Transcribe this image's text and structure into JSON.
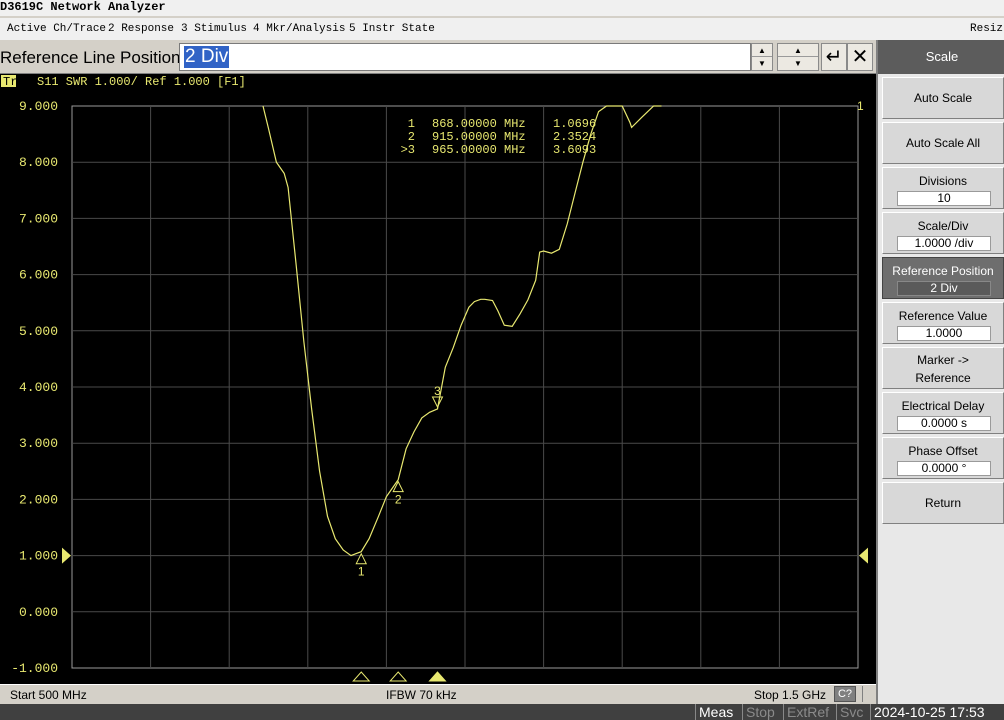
{
  "window": {
    "title": "D3619C Network Analyzer"
  },
  "menu": {
    "items": [
      "Active Ch/Trace",
      "2 Response",
      "3 Stimulus",
      "4 Mkr/Analysis",
      "5 Instr State"
    ],
    "resize_label": "Resiz"
  },
  "entry": {
    "label": "Reference Line Position",
    "value": "2 Div"
  },
  "trace": {
    "badge": "Tr1",
    "header": "S11  SWR 1.000/ Ref 1.000 [F1]",
    "color": "#e8e870",
    "ref_right_label": "1"
  },
  "markers": {
    "readout": [
      {
        "prefix": "1",
        "freq": "868.00000 MHz",
        "value": "1.0696"
      },
      {
        "prefix": "2",
        "freq": "915.00000 MHz",
        "value": "2.3524"
      },
      {
        "prefix": ">3",
        "freq": "965.00000 MHz",
        "value": "3.6093"
      }
    ],
    "labels": [
      "1",
      "2",
      "3"
    ]
  },
  "status": {
    "start": "Start 500 MHz",
    "ifbw": "IFBW 70 kHz",
    "stop": "Stop 1.5 GHz",
    "channel": "C?"
  },
  "bottom": {
    "meas": "Meas",
    "stop": "Stop",
    "extref": "ExtRef",
    "svc": "Svc",
    "datetime": "2024-10-25 17:53"
  },
  "softkeys": {
    "title": "Scale",
    "auto_scale": "Auto Scale",
    "auto_scale_all": "Auto Scale All",
    "divisions": {
      "label": "Divisions",
      "value": "10"
    },
    "scale_div": {
      "label": "Scale/Div",
      "value": "1.0000 /div"
    },
    "ref_position": {
      "label": "Reference Position",
      "value": "2 Div"
    },
    "ref_value": {
      "label": "Reference Value",
      "value": "1.0000"
    },
    "marker_ref": {
      "line1": "Marker ->",
      "line2": "Reference"
    },
    "elec_delay": {
      "label": "Electrical Delay",
      "value": "0.0000 s"
    },
    "phase_offset": {
      "label": "Phase Offset",
      "value": "0.0000 °"
    },
    "return": "Return"
  },
  "chart_data": {
    "type": "line",
    "xlabel": "",
    "ylabel": "",
    "xlim": [
      500,
      1500
    ],
    "ylim": [
      -1,
      9
    ],
    "y_ticks": [
      "9.000",
      "8.000",
      "7.000",
      "6.000",
      "5.000",
      "4.000",
      "3.000",
      "2.000",
      "1.000",
      "0.000",
      "-1.000"
    ],
    "grid": true,
    "reference_value": 1.0,
    "series": [
      {
        "x": [
          743,
          750,
          760,
          770,
          775,
          785,
          795,
          805,
          815,
          825,
          835,
          845,
          855,
          862,
          868,
          878,
          890,
          900,
          915,
          925,
          935,
          945,
          955,
          965,
          975,
          985,
          995,
          1005,
          1012,
          1020,
          1025,
          1035,
          1042,
          1050,
          1060,
          1070,
          1080,
          1090,
          1095,
          1100,
          1110,
          1120,
          1130,
          1140,
          1150,
          1160,
          1170,
          1180,
          1190,
          1200,
          1210,
          1212,
          1225,
          1240,
          1250
        ],
        "y": [
          9.0,
          8.6,
          8.0,
          7.8,
          7.55,
          6.2,
          4.8,
          3.6,
          2.5,
          1.7,
          1.3,
          1.1,
          1.0,
          1.04,
          1.07,
          1.3,
          1.7,
          2.05,
          2.35,
          2.9,
          3.2,
          3.45,
          3.55,
          3.61,
          4.35,
          4.7,
          5.1,
          5.42,
          5.52,
          5.56,
          5.56,
          5.54,
          5.35,
          5.1,
          5.08,
          5.3,
          5.55,
          5.9,
          6.4,
          6.42,
          6.38,
          6.45,
          6.9,
          7.45,
          8.0,
          8.5,
          8.9,
          9.0,
          9.0,
          9.0,
          8.7,
          8.62,
          8.8,
          9.0,
          9.0
        ]
      }
    ]
  }
}
